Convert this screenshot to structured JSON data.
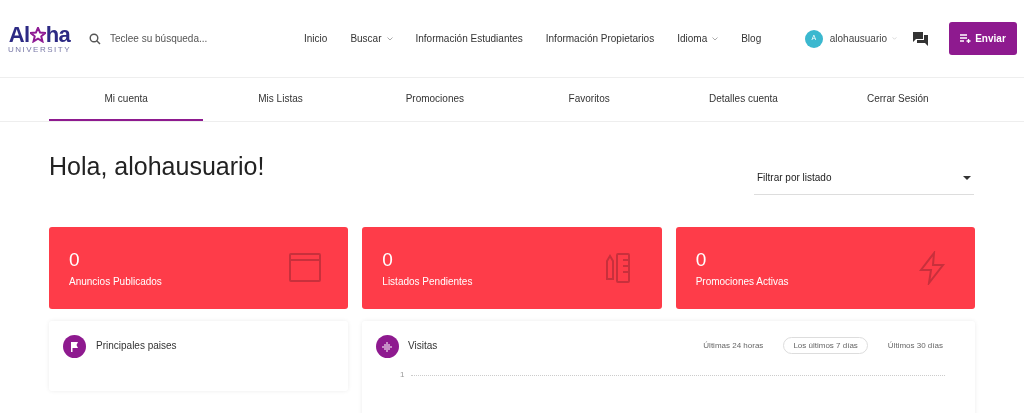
{
  "logo": {
    "left": "Al",
    "right": "ha",
    "sub": "UNIVERSITY"
  },
  "search": {
    "placeholder": "Teclee su búsqueda..."
  },
  "nav": [
    {
      "label": "Inicio",
      "dropdown": false
    },
    {
      "label": "Buscar",
      "dropdown": true
    },
    {
      "label": "Información Estudiantes",
      "dropdown": false
    },
    {
      "label": "Información Propietarios",
      "dropdown": false
    },
    {
      "label": "Idioma",
      "dropdown": true
    },
    {
      "label": "Blog",
      "dropdown": false
    }
  ],
  "user": {
    "initial": "A",
    "name": "alohausuario"
  },
  "submit_button": "Enviar",
  "tabs": [
    {
      "label": "Mi cuenta",
      "selected": true
    },
    {
      "label": "Mis Listas",
      "selected": false
    },
    {
      "label": "Promociones",
      "selected": false
    },
    {
      "label": "Favoritos",
      "selected": false
    },
    {
      "label": "Detalles cuenta",
      "selected": false
    },
    {
      "label": "Cerrar Sesión",
      "selected": false
    }
  ],
  "greeting": "Hola, alohausuario!",
  "filter": {
    "value": "Filtrar por listado"
  },
  "stats": [
    {
      "value": "0",
      "label": "Anuncios Publicados",
      "kind": "window"
    },
    {
      "value": "0",
      "label": "Listados Pendientes",
      "kind": "tools"
    },
    {
      "value": "0",
      "label": "Promociones Activas",
      "kind": "bolt"
    }
  ],
  "countries_panel": {
    "title": "Principales paises"
  },
  "visits_panel": {
    "title": "Visitas",
    "ranges": [
      {
        "label": "Últimas 24 horas",
        "selected": false
      },
      {
        "label": "Los últimos 7 días",
        "selected": true
      },
      {
        "label": "Últimos 30 días",
        "selected": false
      }
    ],
    "y_tick": "1"
  }
}
